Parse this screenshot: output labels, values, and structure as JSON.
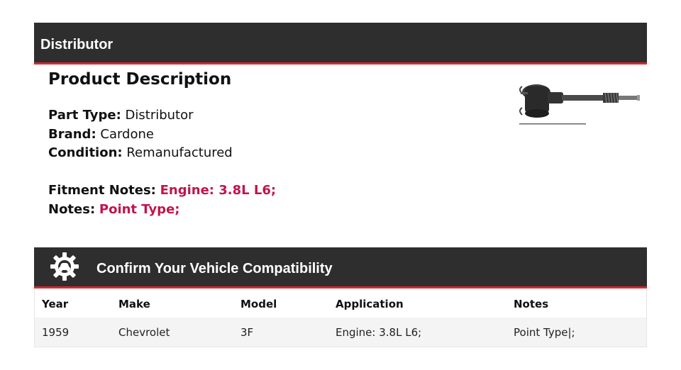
{
  "header": {
    "title": "Distributor"
  },
  "description": {
    "heading": "Product Description",
    "part_type_label": "Part Type:",
    "part_type_value": "Distributor",
    "brand_label": "Brand:",
    "brand_value": "Cardone",
    "condition_label": "Condition:",
    "condition_value": "Remanufactured",
    "fitment_label": "Fitment Notes:",
    "fitment_value": "Engine: 3.8L L6;",
    "notes_label": "Notes:",
    "notes_value": "Point Type;"
  },
  "image": {
    "icon": "distributor-product-image"
  },
  "compat": {
    "title": "Confirm Your Vehicle Compatibility",
    "icon": "gear-car-icon",
    "columns": [
      "Year",
      "Make",
      "Model",
      "Application",
      "Notes"
    ],
    "rows": [
      [
        "1959",
        "Chevrolet",
        "3F",
        "Engine: 3.8L L6;",
        "Point Type|;"
      ]
    ]
  },
  "colors": {
    "bar": "#2e2e2e",
    "accent": "#d9272e",
    "highlight": "#c2144a"
  }
}
